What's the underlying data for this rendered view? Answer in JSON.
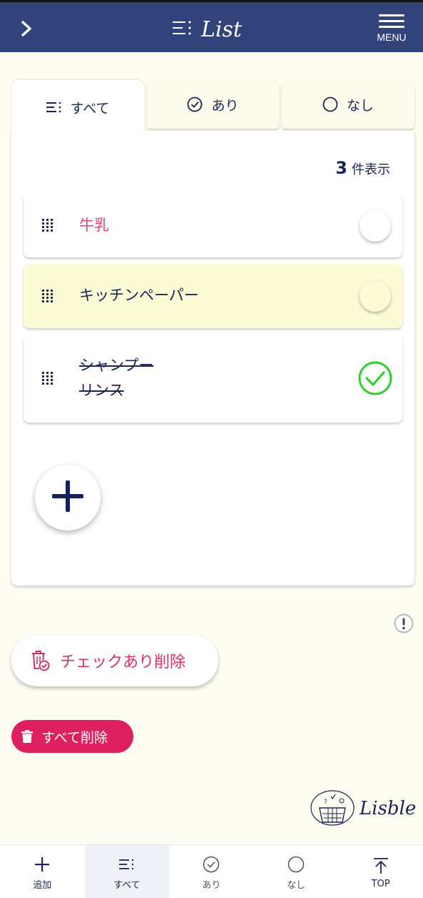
{
  "header": {
    "title": "List",
    "menu_label": "MENU"
  },
  "tabs": [
    {
      "label": "すべて",
      "icon": "list-icon",
      "active": true
    },
    {
      "label": "あり",
      "icon": "check-circle-icon",
      "active": false
    },
    {
      "label": "なし",
      "icon": "circle-icon",
      "active": false
    }
  ],
  "count": {
    "number": "3",
    "suffix": "件表示"
  },
  "items": [
    {
      "text": "牛乳",
      "checked": false,
      "color": "#e0417a"
    },
    {
      "text": "キッチンペーパー",
      "checked": false,
      "highlighted": true
    },
    {
      "text_line1": "シャンプー",
      "text_line2": "リンス",
      "checked": true
    }
  ],
  "actions": {
    "delete_checked": "チェックあり削除",
    "delete_all": "すべて削除"
  },
  "brand": {
    "name": "Lisble"
  },
  "bottom_nav": [
    {
      "label": "追加",
      "icon": "plus-icon"
    },
    {
      "label": "すべて",
      "icon": "list-icon",
      "active": true
    },
    {
      "label": "あり",
      "icon": "check-circle-icon"
    },
    {
      "label": "なし",
      "icon": "circle-icon"
    },
    {
      "label": "TOP",
      "icon": "arrow-up-icon"
    }
  ],
  "colors": {
    "header": "#32427a",
    "accent_pink": "#df2060",
    "check_green": "#33cc33",
    "background": "#fefdf1"
  }
}
